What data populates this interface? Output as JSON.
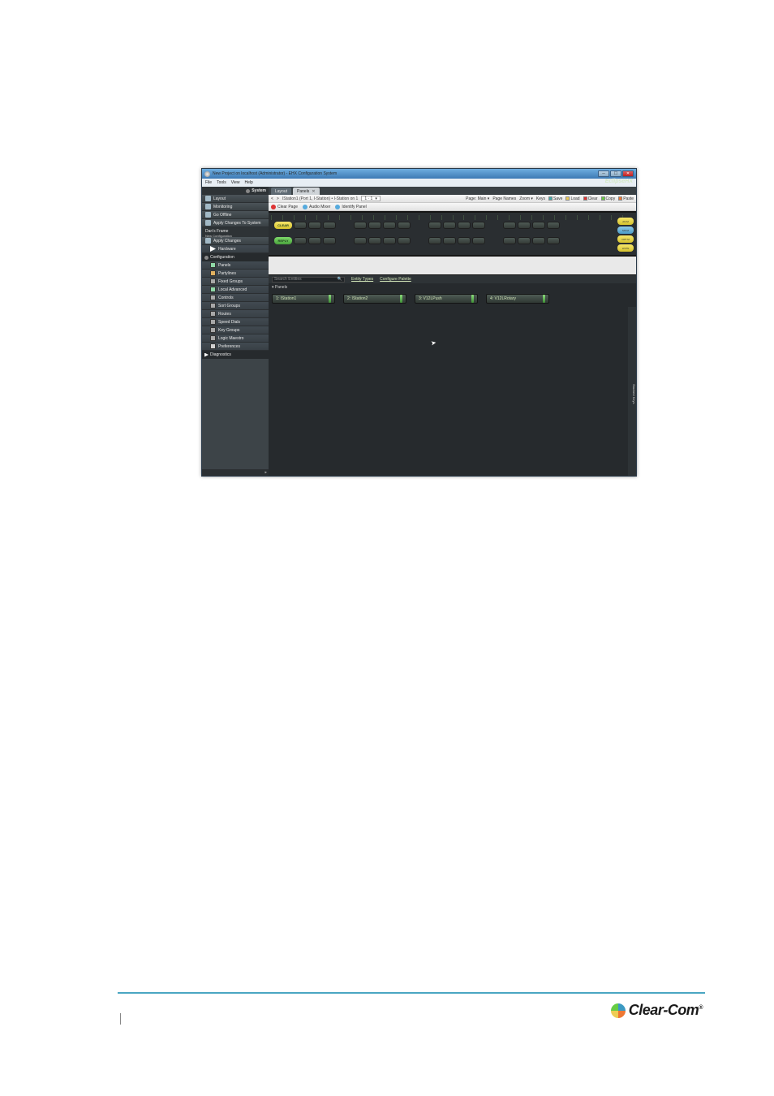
{
  "window": {
    "title": "New Project on localhost (Administrator) - EHX Configuration System",
    "menus": [
      "File",
      "Tools",
      "View",
      "Help"
    ],
    "brand": "EclipseHX"
  },
  "sidebar": {
    "system": {
      "title": "System",
      "items": [
        {
          "label": "Layout"
        },
        {
          "label": "Monitoring"
        },
        {
          "label": "Go Offline"
        },
        {
          "label": "Apply Changes To System"
        }
      ]
    },
    "frame": {
      "name": "Dan's Frame",
      "subtitle": "New Configuration",
      "items": [
        {
          "label": "Apply Changes"
        },
        {
          "label": "Hardware"
        }
      ]
    },
    "configuration": {
      "title": "Configuration",
      "items": [
        {
          "label": "Panels"
        },
        {
          "label": "Partylines"
        },
        {
          "label": "Fixed Groups"
        },
        {
          "label": "Local Advanced"
        },
        {
          "label": "Controls"
        },
        {
          "label": "Sort Groups"
        },
        {
          "label": "Routes"
        },
        {
          "label": "Speed Dials"
        },
        {
          "label": "Key Groups"
        },
        {
          "label": "Logic Maestro"
        },
        {
          "label": "Preferences"
        }
      ]
    },
    "diagnostics": {
      "title": "Diagnostics"
    }
  },
  "tabs": {
    "layout": "Layout",
    "panels": "Panels"
  },
  "toolbar": {
    "nav_back": "<",
    "nav_fwd": ">",
    "breadcrumb": "IStation1  (Port 1, I-Station) • I-Station on 1",
    "page_combo": "1 · 1",
    "actions": {
      "page": "Page: Main ▾",
      "names": "Page Names",
      "zoom": "Zoom ▾",
      "keys": "Keys",
      "save": "Save",
      "load": "Load",
      "clear": "Clear",
      "copy": "Copy",
      "paste": "Paste"
    }
  },
  "toolbar2": {
    "clear_page": "Clear Page",
    "audio_mixer": "Audio Mixer",
    "identify_panel": "Identify Panel"
  },
  "device": {
    "left_top": "CLEAR",
    "left_bottom": "REPLY",
    "side_buttons": [
      "AN.M",
      "MS M",
      "OPT M",
      "LISTN"
    ]
  },
  "palette": {
    "search_label": "Search Entities",
    "search_icon": "🔍",
    "entity_types": "Entity Types",
    "configure": "Configure Palette",
    "expander": "▾  Panels",
    "stacked_label": "Stacked Keys",
    "cards": [
      {
        "label": "1: IStation1"
      },
      {
        "label": "2: IStation2"
      },
      {
        "label": "3: V12LPush"
      },
      {
        "label": "4: V12LRotary"
      }
    ]
  },
  "page_footer": {
    "brand": "Clear-Com"
  }
}
